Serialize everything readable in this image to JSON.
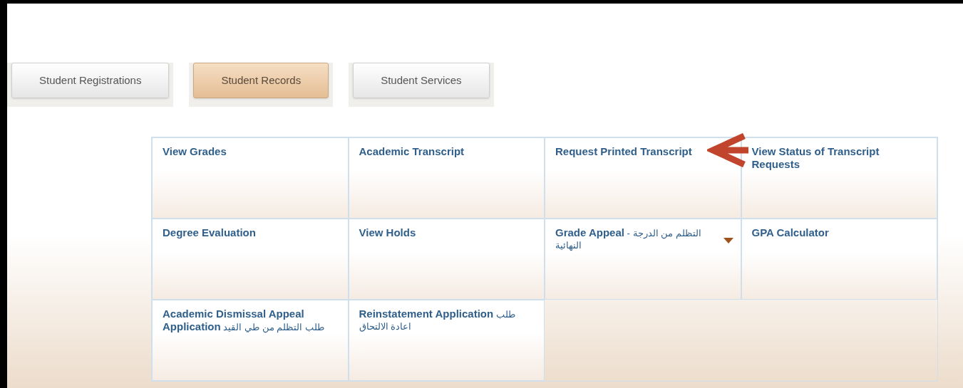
{
  "tabs": [
    {
      "label": "Student Registrations",
      "selected": false
    },
    {
      "label": "Student Records",
      "selected": true
    },
    {
      "label": "Student Services",
      "selected": false
    }
  ],
  "menu": [
    {
      "label": "**View Grades**",
      "dropdown": false
    },
    {
      "label": "**Academic Transcript**",
      "dropdown": false
    },
    {
      "label": "**Request Printed Transcript**",
      "dropdown": false
    },
    {
      "label": "**View Status of Transcript Requests**",
      "dropdown": false
    },
    {
      "label": "**Degree Evaluation**",
      "dropdown": false
    },
    {
      "label": "**View Holds**",
      "dropdown": false
    },
    {
      "label": "**Grade Appeal** - التظلم من الدرجة النهائية",
      "dropdown": true
    },
    {
      "label": "**GPA Calculator**",
      "dropdown": false
    },
    {
      "label": "**Academic Dismissal Appeal Application** طلب التظلم من طي القيد",
      "dropdown": false
    },
    {
      "label": "**Reinstatement Application** طلب اعادة الالتحاق",
      "dropdown": false
    }
  ]
}
